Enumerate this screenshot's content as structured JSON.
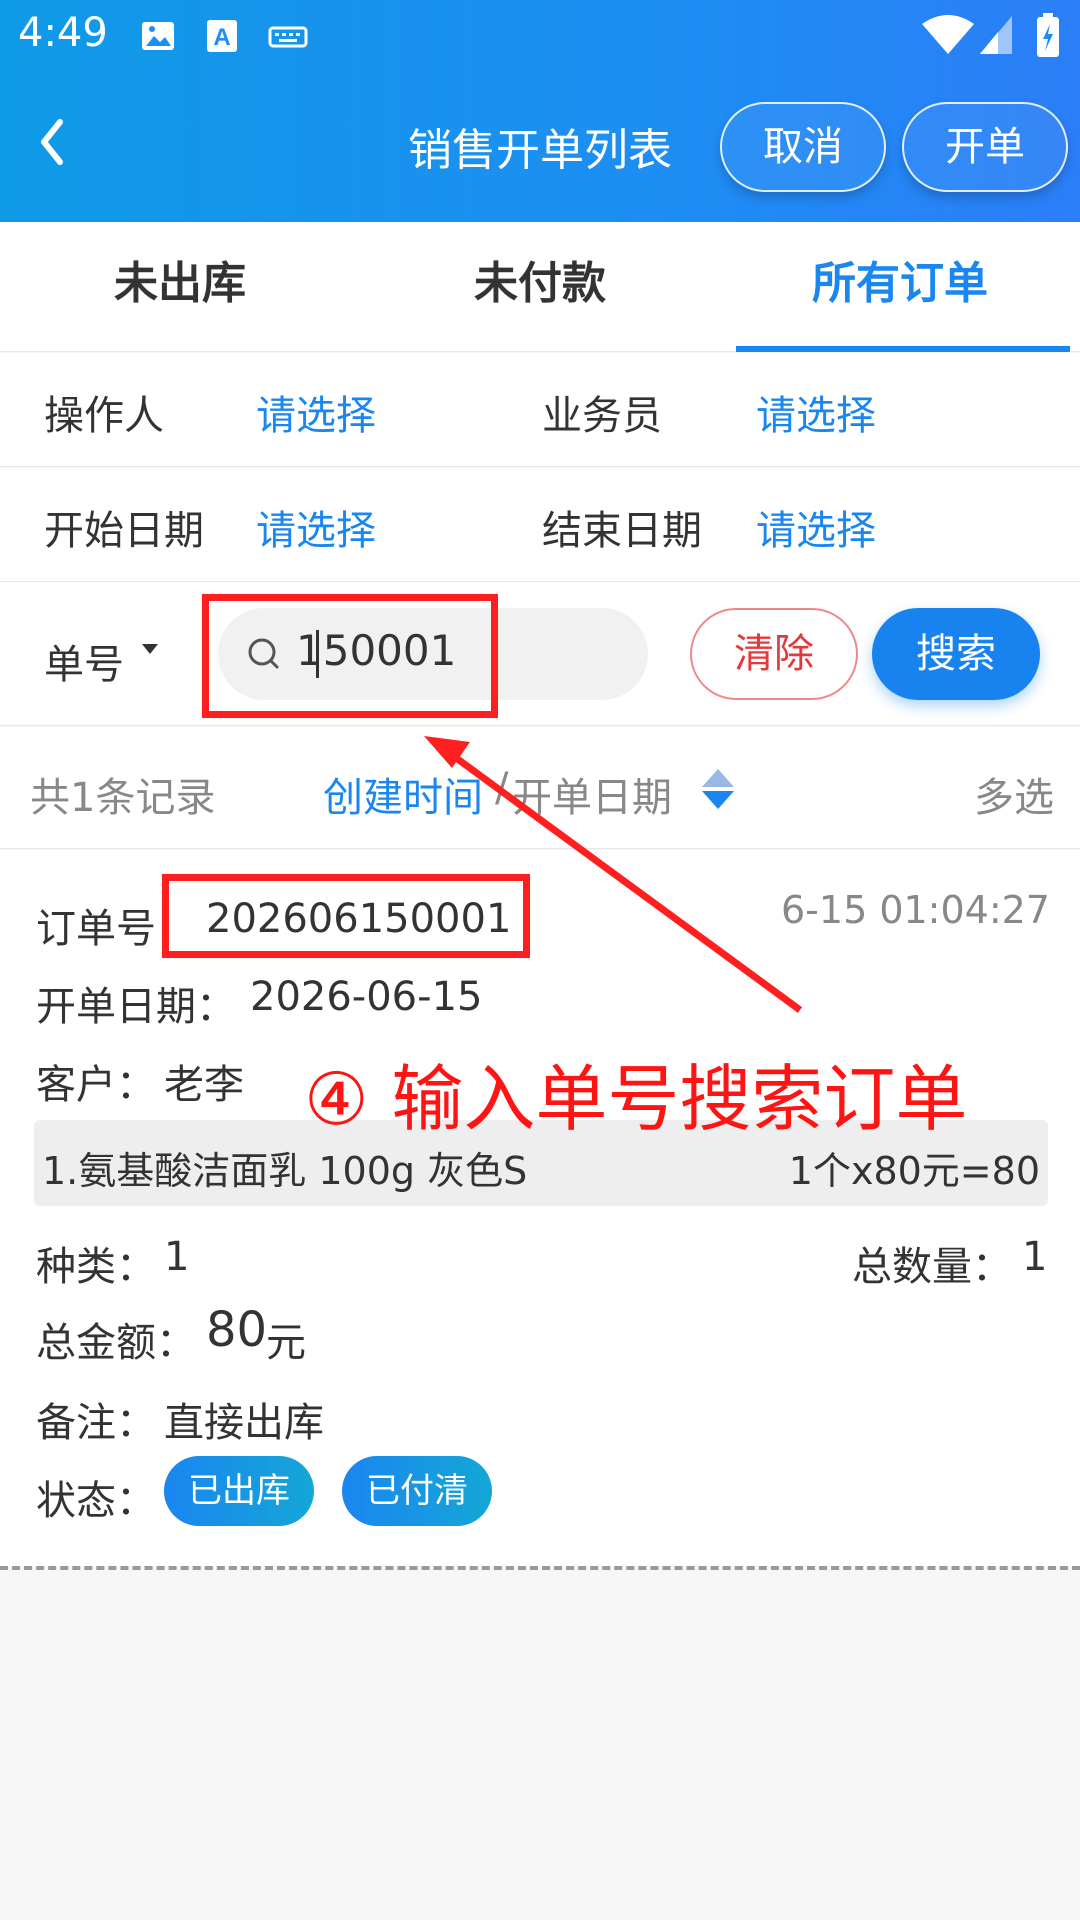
{
  "status_bar": {
    "time": "4:49"
  },
  "header": {
    "title": "销售开单列表",
    "cancel_label": "取消",
    "open_label": "开单"
  },
  "tabs": [
    {
      "label": "未出库",
      "active": false
    },
    {
      "label": "未付款",
      "active": false
    },
    {
      "label": "所有订单",
      "active": true
    }
  ],
  "filters": {
    "operator_label": "操作人",
    "operator_value": "请选择",
    "salesman_label": "业务员",
    "salesman_value": "请选择",
    "start_label": "开始日期",
    "start_value": "请选择",
    "end_label": "结束日期",
    "end_value": "请选择"
  },
  "search": {
    "field_label": "单号",
    "input_value": "150001",
    "clear_label": "清除",
    "search_label": "搜索"
  },
  "summary": {
    "count_text": "共1条记录",
    "sort_created": "创建时间",
    "sort_sep": "/",
    "sort_open_date": "开单日期",
    "multi_select": "多选"
  },
  "order": {
    "order_no_label": "订单号：",
    "order_no": "202606150001",
    "created_time": "6-15 01:04:27",
    "open_date_label": "开单日期：",
    "open_date": "2026-06-15",
    "customer_label": "客户：",
    "customer": "老李",
    "item_desc": "1.氨基酸洁面乳 100g 灰色S",
    "item_calc": "1个x80元=80",
    "kinds_label": "种类：",
    "kinds": "1",
    "total_qty_label": "总数量：",
    "total_qty": "1",
    "total_amount_label": "总金额：",
    "total_amount": "80",
    "total_amount_unit": "元",
    "remark_label": "备注：",
    "remark": "直接出库",
    "status_label": "状态：",
    "status_badges": [
      "已出库",
      "已付清"
    ]
  },
  "annotation": {
    "text": "④ 输入单号搜索订单",
    "color": "#ff1f1f"
  },
  "colors": {
    "header_gradient_start": "#0f9ae6",
    "accent": "#1a86f0",
    "danger": "#e5383b"
  }
}
